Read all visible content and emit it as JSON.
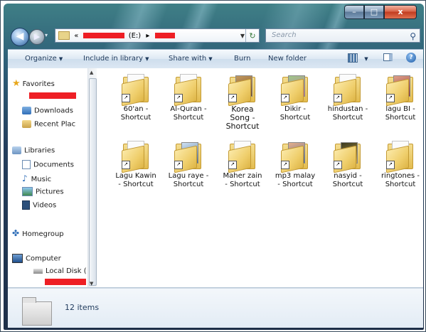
{
  "window": {
    "minimize_glyph": "–",
    "maximize_glyph": "□",
    "close_glyph": "x"
  },
  "address_bar": {
    "history_glyph": "▾",
    "path_prefix": "«",
    "drive_label": "(E:)",
    "separator": "▸",
    "refresh_glyph": "↻"
  },
  "search": {
    "placeholder": "Search",
    "icon": "search-icon"
  },
  "toolbar": {
    "organize": "Organize",
    "include_in_library": "Include in library",
    "share_with": "Share with",
    "burn": "Burn",
    "new_folder": "New folder"
  },
  "nav_pane": {
    "favorites": "Favorites",
    "downloads": "Downloads",
    "recent_places": "Recent Plac",
    "libraries": "Libraries",
    "documents": "Documents",
    "music": "Music",
    "pictures": "Pictures",
    "videos": "Videos",
    "homegroup": "Homegroup",
    "computer": "Computer",
    "local_disk": "Local Disk ("
  },
  "files": [
    {
      "label": "60'an -\nShortcut",
      "type": "folder"
    },
    {
      "label": "Al-Quran -\nShortcut",
      "type": "folder"
    },
    {
      "label": "Korea\nSong -\nShortcut",
      "type": "photo-folder"
    },
    {
      "label": "Dikir -\nShortcut",
      "type": "photo-folder"
    },
    {
      "label": "hindustan -\nShortcut",
      "type": "folder"
    },
    {
      "label": "lagu BI -\nShortcut",
      "type": "photo-folder"
    },
    {
      "label": "Lagu Kawin\n- Shortcut",
      "type": "folder"
    },
    {
      "label": "Lagu raye -\nShortcut",
      "type": "photo-folder"
    },
    {
      "label": "Maher zain\n- Shortcut",
      "type": "folder"
    },
    {
      "label": "mp3 malay\n- Shortcut",
      "type": "photo-folder"
    },
    {
      "label": "nasyid -\nShortcut",
      "type": "photo-folder"
    },
    {
      "label": "ringtones -\nShortcut",
      "type": "folder"
    }
  ],
  "status": {
    "item_count": "12 items"
  },
  "colors": {
    "redaction": "#ee1f25",
    "toolbar_text": "#1e395b"
  }
}
